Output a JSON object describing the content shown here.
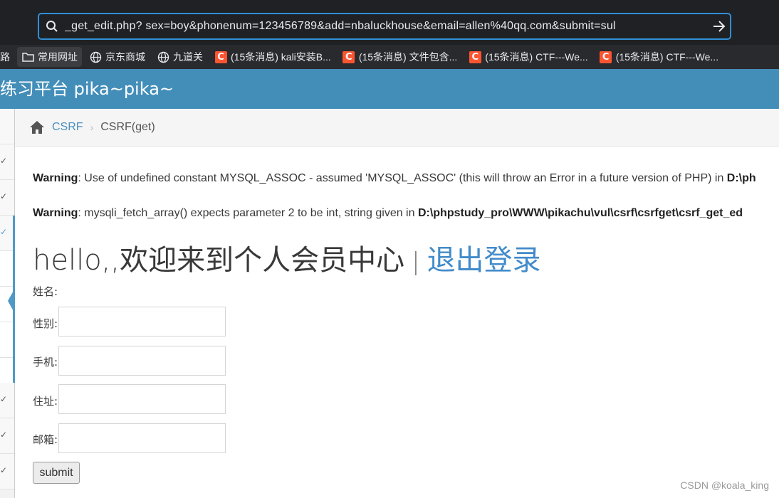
{
  "browser": {
    "url": "_get_edit.php?  sex=boy&phonenum=123456789&add=nbaluckhouse&email=allen%40qq.com&submit=sul",
    "bookmarks": [
      {
        "label": "路",
        "icon": "none"
      },
      {
        "label": "常用网址",
        "icon": "folder-icon"
      },
      {
        "label": "京东商城",
        "icon": "globe-icon"
      },
      {
        "label": "九道关",
        "icon": "globe-icon"
      },
      {
        "label": "(15条消息) kali安装B...",
        "icon": "csdn-icon"
      },
      {
        "label": "(15条消息) 文件包含...",
        "icon": "csdn-icon"
      },
      {
        "label": "(15条消息) CTF---We...",
        "icon": "csdn-icon"
      },
      {
        "label": "(15条消息) CTF---We...",
        "icon": "csdn-icon"
      }
    ]
  },
  "header": {
    "title": "练习平台 pika~pika~"
  },
  "breadcrumb": {
    "link": "CSRF",
    "current": "CSRF(get)"
  },
  "warnings": [
    {
      "label": "Warning",
      "text": ": Use of undefined constant MYSQL_ASSOC - assumed 'MYSQL_ASSOC' (this will throw an Error in a future version of PHP) in ",
      "path": "D:\\ph"
    },
    {
      "label": "Warning",
      "text": ": mysqli_fetch_array() expects parameter 2 to be int, string given in ",
      "path": "D:\\phpstudy_pro\\WWW\\pikachu\\vul\\csrf\\csrfget\\csrf_get_ed"
    }
  ],
  "member": {
    "greeting": "hello,,欢迎来到个人会员中心",
    "separator": "|",
    "logout": "退出登录",
    "name_label": "姓名:",
    "fields": [
      {
        "label": "性别:"
      },
      {
        "label": "手机:"
      },
      {
        "label": "住址:"
      },
      {
        "label": "邮箱:"
      }
    ],
    "submit": "submit"
  },
  "watermark": "CSDN @koala_king",
  "colors": {
    "header_bg": "#438eb9",
    "link": "#428bca",
    "urlbar_border": "#2f8fd8",
    "csdn": "#fc5531"
  }
}
